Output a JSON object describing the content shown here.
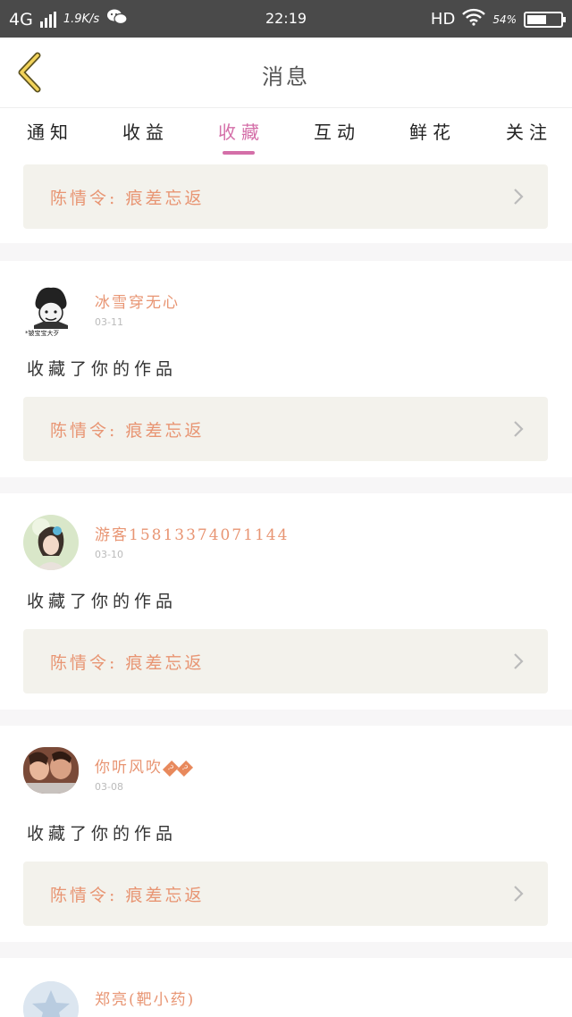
{
  "status_bar": {
    "network": "4G",
    "speed": "1.9K/s",
    "time": "22:19",
    "hd": "HD",
    "battery": "54%"
  },
  "header": {
    "title": "消息",
    "back_icon": "chevron-left-icon"
  },
  "tabs": [
    {
      "label": "通知"
    },
    {
      "label": "收益"
    },
    {
      "label": "收藏",
      "active": true
    },
    {
      "label": "互动"
    },
    {
      "label": "鲜花"
    },
    {
      "label": "关注"
    }
  ],
  "colors": {
    "accent": "#d46fa8",
    "username": "#e89573",
    "work_bg": "#f3f2ec",
    "status_bar": "#4a4a4a"
  },
  "top_item": {
    "work": "陈情令:  痕差忘返"
  },
  "items": [
    {
      "username": "冰雪穿无心",
      "date": "03-11",
      "action": "收藏了你的作品",
      "work": "陈情令:  痕差忘返",
      "avatar_caption": "*铍宝宝大歹"
    },
    {
      "username": "游客15813374071144",
      "date": "03-10",
      "action": "收藏了你的作品",
      "work": "陈情令:  痕差忘返"
    },
    {
      "username": "你听风吹",
      "date": "03-08",
      "action": "收藏了你的作品",
      "work": "陈情令:  痕差忘返"
    },
    {
      "username": "郑亮(靶小药)"
    }
  ]
}
